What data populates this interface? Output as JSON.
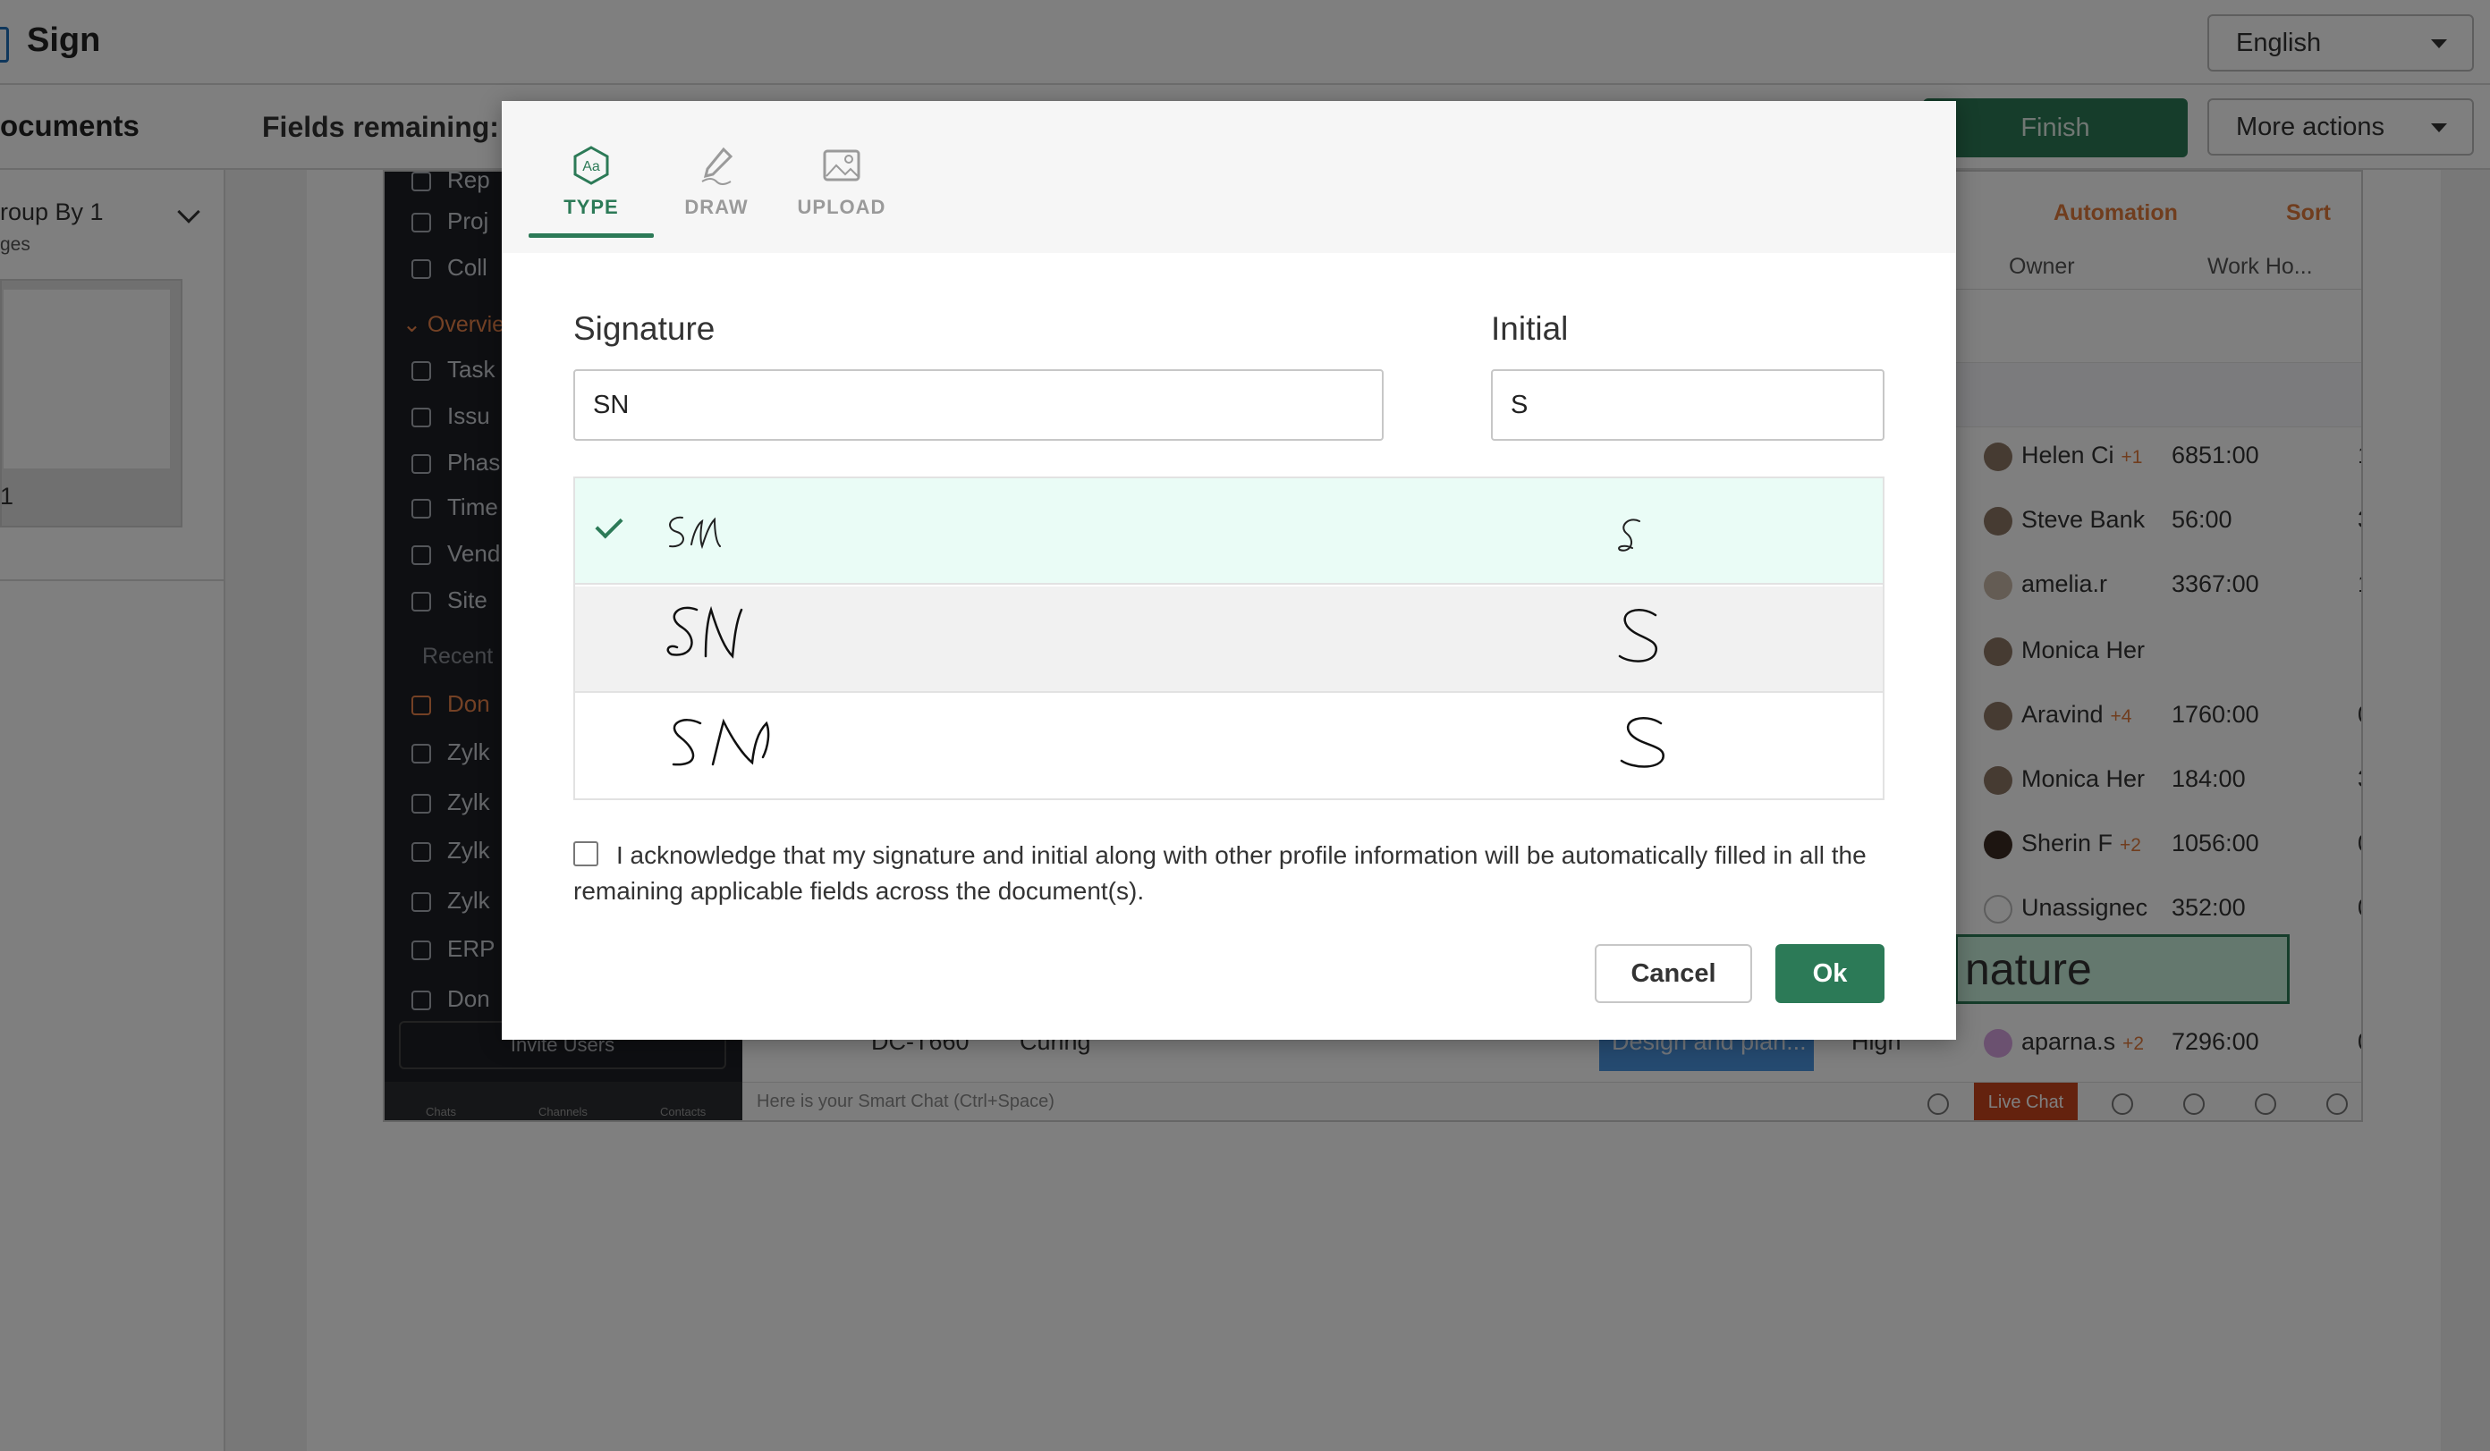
{
  "app": {
    "title": "Sign",
    "language": "English"
  },
  "header": {
    "documents_title": "ocuments",
    "fields_remaining": "Fields remaining:",
    "finish_label": "Finish",
    "more_actions_label": "More actions"
  },
  "left_panel": {
    "group_by": "roup By 1",
    "group_sub": "ges",
    "page_number": "1"
  },
  "background": {
    "sidebar": {
      "items_top": [
        "Rep",
        "Proj",
        "Coll"
      ],
      "overview_label": "Overvie",
      "overview_items": [
        "Task",
        "Issu",
        "Phas",
        "Time",
        "Vend",
        "Site"
      ],
      "recent_label": "Recent",
      "recent_items": [
        "Don",
        "Zylk",
        "Zylk",
        "Zylk",
        "Zylk",
        "ERP",
        "Don"
      ],
      "invite_label": "Invite Users",
      "footer": [
        "Chats",
        "Channels",
        "Contacts"
      ]
    },
    "toolbar": {
      "automation": "Automation",
      "sort": "Sort"
    },
    "columns": {
      "owner": "Owner",
      "work_hours": "Work Ho..."
    },
    "rows": [
      {
        "owner": "Helen Ci",
        "plus": "+1",
        "hours": "6851:00",
        "extra": "1"
      },
      {
        "owner": "Steve Bank",
        "plus": "",
        "hours": "56:00",
        "extra": "3"
      },
      {
        "owner": "amelia.r",
        "plus": "",
        "hours": "3367:00",
        "extra": "1"
      },
      {
        "owner": "Monica Her",
        "plus": "",
        "hours": "",
        "extra": ""
      },
      {
        "owner": "Aravind",
        "plus": "+4",
        "hours": "1760:00",
        "extra": "0"
      },
      {
        "owner": "Monica Her",
        "plus": "",
        "hours": "184:00",
        "extra": "3"
      },
      {
        "owner": "Sherin F",
        "plus": "+2",
        "hours": "1056:00",
        "extra": "0"
      },
      {
        "owner": "Unassignec",
        "plus": "",
        "hours": "352:00",
        "extra": "0"
      },
      {
        "owner": "aparna.s",
        "plus": "+2",
        "hours": "7296:00",
        "extra": "0"
      }
    ],
    "bottom_row": {
      "id": "DC-T660",
      "name": "Curing",
      "task": "Design and plan...",
      "priority": "High"
    },
    "signature_field": "nature",
    "smart_chat": "Here is your Smart Chat (Ctrl+Space)",
    "live_chat": "Live Chat"
  },
  "modal": {
    "tabs": [
      {
        "label": "TYPE",
        "icon": "type-icon",
        "active": true
      },
      {
        "label": "DRAW",
        "icon": "draw-icon",
        "active": false
      },
      {
        "label": "UPLOAD",
        "icon": "upload-icon",
        "active": false
      }
    ],
    "signature_label": "Signature",
    "signature_value": "SN",
    "initial_label": "Initial",
    "initial_value": "S",
    "styles": [
      {
        "signature": "SN",
        "initial": "S",
        "selected": true
      },
      {
        "signature": "SN",
        "initial": "S",
        "selected": false
      },
      {
        "signature": "SN",
        "initial": "S",
        "selected": false
      }
    ],
    "acknowledge_text": "I acknowledge that my signature and initial along with other profile information will be automatically filled in all the remaining applicable fields across the document(s).",
    "cancel_label": "Cancel",
    "ok_label": "Ok"
  },
  "colors": {
    "accent": "#2c7a57",
    "selected_row": "#eafcf6",
    "orange": "#e07a3c"
  }
}
